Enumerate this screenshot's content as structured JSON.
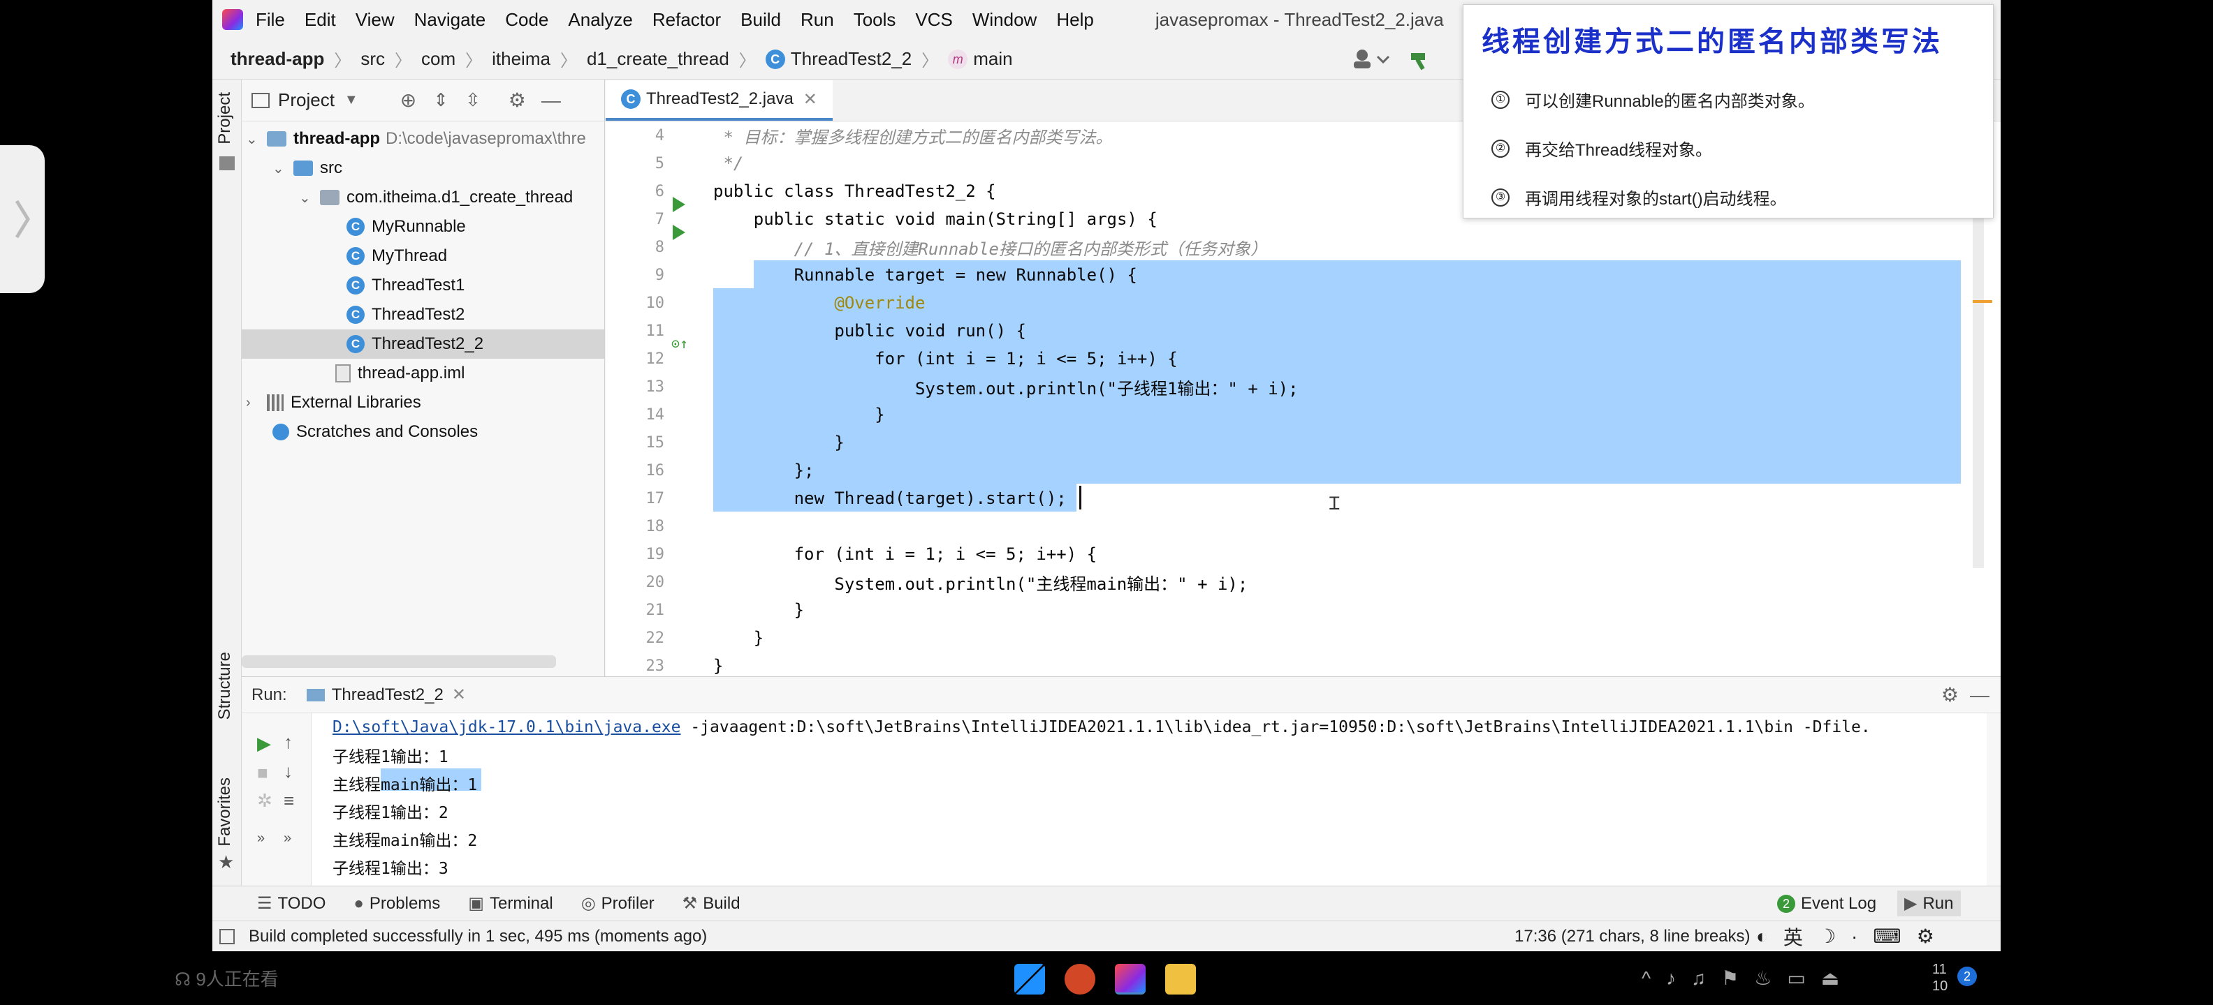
{
  "menubar": {
    "items": [
      "File",
      "Edit",
      "View",
      "Navigate",
      "Code",
      "Analyze",
      "Refactor",
      "Build",
      "Run",
      "Tools",
      "VCS",
      "Window",
      "Help"
    ],
    "window_title": "javasepromax - ThreadTest2_2.java"
  },
  "breadcrumb": [
    "thread-app",
    "src",
    "com",
    "itheima",
    "d1_create_thread",
    "ThreadTest2_2",
    "main"
  ],
  "left_tool_tabs": {
    "project": "Project",
    "structure": "Structure",
    "favorites": "Favorites"
  },
  "project_panel": {
    "title": "Project",
    "tree": [
      {
        "label": "thread-app",
        "extra": "D:\\code\\javasepromax\\thre"
      },
      {
        "label": "src"
      },
      {
        "label": "com.itheima.d1_create_thread"
      },
      {
        "label": "MyRunnable"
      },
      {
        "label": "MyThread"
      },
      {
        "label": "ThreadTest1"
      },
      {
        "label": "ThreadTest2"
      },
      {
        "label": "ThreadTest2_2"
      },
      {
        "label": "thread-app.iml"
      },
      {
        "label": "External Libraries"
      },
      {
        "label": "Scratches and Consoles"
      }
    ]
  },
  "editor": {
    "tab": "ThreadTest2_2.java",
    "lines": [
      {
        "n": "4",
        "text": " * 目标：掌握多线程创建方式二的匿名内部类写法。"
      },
      {
        "n": "5",
        "text": " */"
      },
      {
        "n": "6",
        "text": "public class ThreadTest2_2 {"
      },
      {
        "n": "7",
        "text": "    public static void main(String[] args) {"
      },
      {
        "n": "8",
        "text": "        // 1、直接创建Runnable接口的匿名内部类形式（任务对象）"
      },
      {
        "n": "9",
        "text": "        Runnable target = new Runnable() {"
      },
      {
        "n": "10",
        "text": "            @Override"
      },
      {
        "n": "11",
        "text": "            public void run() {"
      },
      {
        "n": "12",
        "text": "                for (int i = 1; i <= 5; i++) {"
      },
      {
        "n": "13",
        "text": "                    System.out.println(\"子线程1输出：\" + i);"
      },
      {
        "n": "14",
        "text": "                }"
      },
      {
        "n": "15",
        "text": "            }"
      },
      {
        "n": "16",
        "text": "        };"
      },
      {
        "n": "17",
        "text": "        new Thread(target).start();"
      },
      {
        "n": "18",
        "text": ""
      },
      {
        "n": "19",
        "text": "        for (int i = 1; i <= 5; i++) {"
      },
      {
        "n": "20",
        "text": "            System.out.println(\"主线程main输出：\" + i);"
      },
      {
        "n": "21",
        "text": "        }"
      },
      {
        "n": "22",
        "text": "    }"
      },
      {
        "n": "23",
        "text": "}"
      }
    ]
  },
  "run_panel": {
    "label": "Run:",
    "tab": "ThreadTest2_2",
    "command": "D:\\soft\\Java\\jdk-17.0.1\\bin\\java.exe",
    "command_rest": " -javaagent:D:\\soft\\JetBrains\\IntelliJIDEA2021.1.1\\lib\\idea_rt.jar=10950:D:\\soft\\JetBrains\\IntelliJIDEA2021.1.1\\bin -Dfile.",
    "output": [
      "子线程1输出：1",
      "主线程main输出：1",
      "子线程1输出：2",
      "主线程main输出：2",
      "子线程1输出：3"
    ]
  },
  "bottom_tools": [
    "TODO",
    "Problems",
    "Terminal",
    "Profiler",
    "Build"
  ],
  "event_log": {
    "count": "2",
    "label": "Event Log"
  },
  "run_tool": "Run",
  "status": {
    "message": "Build completed successfully in 1 sec, 495 ms (moments ago)",
    "position": "17:36 (271 chars, 8 line breaks)"
  },
  "ime": {
    "lang": "英"
  },
  "overlay": {
    "title": "线程创建方式二的匿名内部类写法",
    "items": [
      {
        "num": "①",
        "text": "可以创建Runnable的匿名内部类对象。"
      },
      {
        "num": "②",
        "text": "再交给Thread线程对象。"
      },
      {
        "num": "③",
        "text": "再调用线程对象的start()启动线程。"
      }
    ]
  },
  "viewers": "9人正在看",
  "taskbar": {
    "clock": "11\n10",
    "badge": "2"
  }
}
